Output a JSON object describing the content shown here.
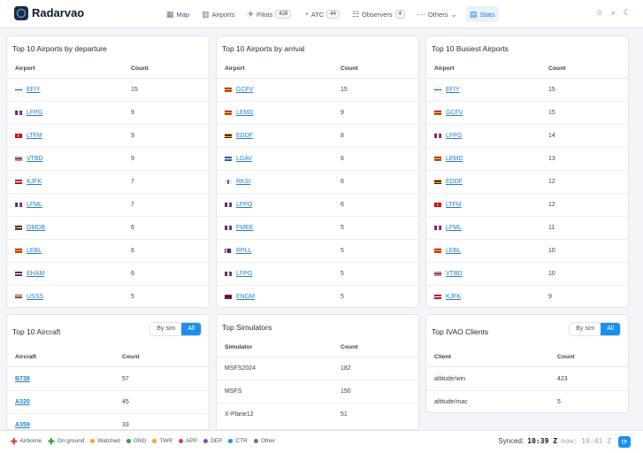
{
  "app": {
    "title": "Radarvao"
  },
  "nav": [
    {
      "label": "Map",
      "icon": "map-icon",
      "glyph": "▦",
      "badge": "",
      "active": false
    },
    {
      "label": "Airports",
      "icon": "airport-icon",
      "glyph": "▥",
      "badge": "",
      "active": false
    },
    {
      "label": "Pilots",
      "icon": "plane-icon",
      "glyph": "✈",
      "badge": "428",
      "active": false
    },
    {
      "label": "ATC",
      "icon": "tower-icon",
      "glyph": "◔",
      "badge": "44",
      "active": false
    },
    {
      "label": "Observers",
      "icon": "users-icon",
      "glyph": "☷",
      "badge": "4",
      "active": false
    },
    {
      "label": "Others",
      "icon": "more-icon",
      "glyph": "⋯",
      "badge": "",
      "active": false,
      "dropdown": true
    },
    {
      "label": "Stats",
      "icon": "stats-icon",
      "glyph": "▤",
      "badge": "",
      "active": true
    }
  ],
  "departures": {
    "title": "Top 10 Airports by departure",
    "col1": "Airport",
    "col2": "Count",
    "rows": [
      {
        "code": "EFIY",
        "count": "15",
        "flag": "fi"
      },
      {
        "code": "LFPG",
        "count": "9",
        "flag": "fr"
      },
      {
        "code": "LTFM",
        "count": "9",
        "flag": "tr"
      },
      {
        "code": "VTBD",
        "count": "9",
        "flag": "th"
      },
      {
        "code": "KJFK",
        "count": "7",
        "flag": "us"
      },
      {
        "code": "LFML",
        "count": "7",
        "flag": "fr"
      },
      {
        "code": "OMDB",
        "count": "6",
        "flag": "ae"
      },
      {
        "code": "LEBL",
        "count": "6",
        "flag": "es"
      },
      {
        "code": "EHAM",
        "count": "6",
        "flag": "nl"
      },
      {
        "code": "USSS",
        "count": "5",
        "flag": "ru"
      }
    ]
  },
  "arrivals": {
    "title": "Top 10 Airports by arrival",
    "col1": "Airport",
    "col2": "Count",
    "rows": [
      {
        "code": "GCFV",
        "count": "15",
        "flag": "es"
      },
      {
        "code": "LEMD",
        "count": "9",
        "flag": "es"
      },
      {
        "code": "EDDF",
        "count": "8",
        "flag": "de"
      },
      {
        "code": "LGAV",
        "count": "6",
        "flag": "gr"
      },
      {
        "code": "RKSI",
        "count": "6",
        "flag": "kr"
      },
      {
        "code": "LFPO",
        "count": "6",
        "flag": "fr"
      },
      {
        "code": "FMEE",
        "count": "5",
        "flag": "fr"
      },
      {
        "code": "RPLL",
        "count": "5",
        "flag": "ph"
      },
      {
        "code": "LFPG",
        "count": "5",
        "flag": "fr"
      },
      {
        "code": "ENGM",
        "count": "5",
        "flag": "no"
      }
    ]
  },
  "busiest": {
    "title": "Top 10 Busiest Airports",
    "col1": "Airport",
    "col2": "Count",
    "rows": [
      {
        "code": "EFIY",
        "count": "15",
        "flag": "fi"
      },
      {
        "code": "GCFV",
        "count": "15",
        "flag": "es"
      },
      {
        "code": "LFPG",
        "count": "14",
        "flag": "fr"
      },
      {
        "code": "LEMD",
        "count": "13",
        "flag": "es"
      },
      {
        "code": "EDDF",
        "count": "12",
        "flag": "de"
      },
      {
        "code": "LTFM",
        "count": "12",
        "flag": "tr"
      },
      {
        "code": "LFML",
        "count": "11",
        "flag": "fr"
      },
      {
        "code": "LEBL",
        "count": "10",
        "flag": "es"
      },
      {
        "code": "VTBD",
        "count": "10",
        "flag": "th"
      },
      {
        "code": "KJFK",
        "count": "9",
        "flag": "us"
      }
    ]
  },
  "aircraft": {
    "title": "Top 10 Aircraft",
    "toggle": [
      "By sim",
      "All"
    ],
    "col1": "Aircraft",
    "col2": "Count",
    "rows": [
      {
        "code": "B738",
        "count": "57"
      },
      {
        "code": "A320",
        "count": "45"
      },
      {
        "code": "A359",
        "count": "33"
      }
    ]
  },
  "simulators": {
    "title": "Top Simulators",
    "col1": "Simulator",
    "col2": "Count",
    "rows": [
      {
        "name": "MSFS2024",
        "count": "182"
      },
      {
        "name": "MSFS",
        "count": "150"
      },
      {
        "name": "X-Plane12",
        "count": "51"
      }
    ]
  },
  "clients": {
    "title": "Top IVAO Clients",
    "toggle": [
      "By sim",
      "All"
    ],
    "col1": "Client",
    "col2": "Count",
    "rows": [
      {
        "name": "altitude/win",
        "count": "423"
      },
      {
        "name": "altitude/mac",
        "count": "5"
      }
    ]
  },
  "legend": [
    {
      "label": "Airborne",
      "color": "#e53935",
      "shape": "plus"
    },
    {
      "label": "On ground",
      "color": "#2e9e3e",
      "shape": "plus"
    },
    {
      "label": "Watched",
      "color": "#f5a623",
      "shape": "dot"
    },
    {
      "label": "GND",
      "color": "#2e9e3e",
      "shape": "dot"
    },
    {
      "label": "TWR",
      "color": "#f5a623",
      "shape": "dot"
    },
    {
      "label": "APP",
      "color": "#e53935",
      "shape": "dot"
    },
    {
      "label": "DEP",
      "color": "#8e44ad",
      "shape": "dot"
    },
    {
      "label": "CTR",
      "color": "#1b8ff0",
      "shape": "dot"
    },
    {
      "label": "Other",
      "color": "#6b7280",
      "shape": "dot"
    }
  ],
  "status": {
    "synced_label": "Synced:",
    "synced_time": "10:39 Z",
    "now_label": "now:",
    "now_time": "10:41 Z"
  }
}
